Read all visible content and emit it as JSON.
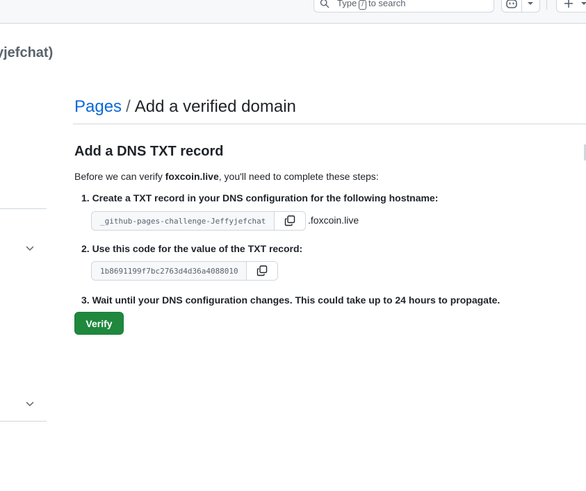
{
  "header": {
    "search_prefix": "Type",
    "search_key": "/",
    "search_suffix": "to search"
  },
  "context_title": "yjefchat)",
  "breadcrumb": {
    "parent": "Pages",
    "separator": "/",
    "current": "Add a verified domain"
  },
  "section": {
    "title": "Add a DNS TXT record",
    "intro_prefix": "Before we can verify ",
    "intro_domain": "foxcoin.live",
    "intro_suffix": ", you'll need to complete these steps:"
  },
  "steps": [
    {
      "text": "1. Create a TXT record in your DNS configuration for the following hostname:"
    },
    {
      "text": "2. Use this code for the value of the TXT record:"
    },
    {
      "text": "3. Wait until your DNS configuration changes. This could take up to 24 hours to propagate."
    }
  ],
  "hostname": {
    "value": "_github-pages-challenge-Jeffyjefchat",
    "suffix": ".foxcoin.live"
  },
  "txt_value": "1b8691199f7bc2763d4d36a4088010",
  "verify_label": "Verify",
  "colors": {
    "link": "#0969da",
    "primary_button": "#1f883d",
    "border": "#d0d7de",
    "muted_text": "#59636e"
  },
  "icons": [
    "search-icon",
    "copilot-icon",
    "chevron-down-icon",
    "plus-icon",
    "copy-icon"
  ]
}
